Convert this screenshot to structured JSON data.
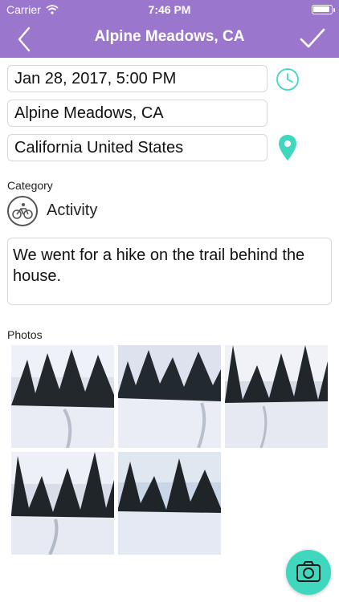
{
  "status_bar": {
    "carrier": "Carrier",
    "time": "7:46 PM",
    "battery_level": 1.0
  },
  "nav": {
    "title": "Alpine Meadows, CA",
    "back_icon": "chevron-left-icon",
    "done_icon": "checkmark-icon"
  },
  "form": {
    "date": "Jan 28, 2017, 5:00 PM",
    "place": "Alpine Meadows, CA",
    "region": "California United States",
    "clock_icon": "clock-icon",
    "location_icon": "location-pin-icon"
  },
  "category": {
    "label": "Category",
    "value": "Activity",
    "icon": "bicycle-icon"
  },
  "notes": "We went for a hike on the trail behind the house.",
  "photos": {
    "label": "Photos",
    "count": 5
  },
  "camera": {
    "icon": "camera-icon"
  },
  "colors": {
    "header": "#9a76cc",
    "accent": "#3fd8be",
    "snow": "#e9ecf4",
    "trees": "#22282c"
  }
}
